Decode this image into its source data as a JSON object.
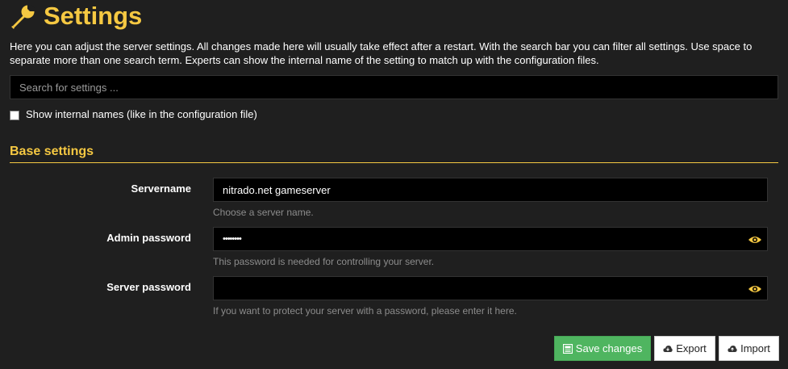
{
  "header": {
    "title": "Settings",
    "icon": "wrench-icon",
    "intro": "Here you can adjust the server settings. All changes made here will usually take effect after a restart. With the search bar you can filter all settings. Use space to separate more than one search term. Experts can show the internal name of the setting to match up with the configuration files."
  },
  "search": {
    "placeholder": "Search for settings ..."
  },
  "internal_names": {
    "label": "Show internal names (like in the configuration file)",
    "checked": false
  },
  "section": {
    "title": "Base settings"
  },
  "fields": [
    {
      "label": "Servername",
      "value": "nitrado.net gameserver",
      "help": "Choose a server name."
    },
    {
      "label": "Admin password",
      "value": "••••••••",
      "help": "This password is needed for controlling your server.",
      "toggle_icon": "eye-icon"
    },
    {
      "label": "Server password",
      "value": "",
      "help": "If you want to protect your server with a password, please enter it here.",
      "toggle_icon": "eye-icon"
    }
  ],
  "buttons": {
    "save": "Save changes",
    "export": "Export",
    "import": "Import"
  },
  "colors": {
    "accent": "#f5c842",
    "background": "#1f1f1f",
    "save_button": "#4fb560"
  }
}
